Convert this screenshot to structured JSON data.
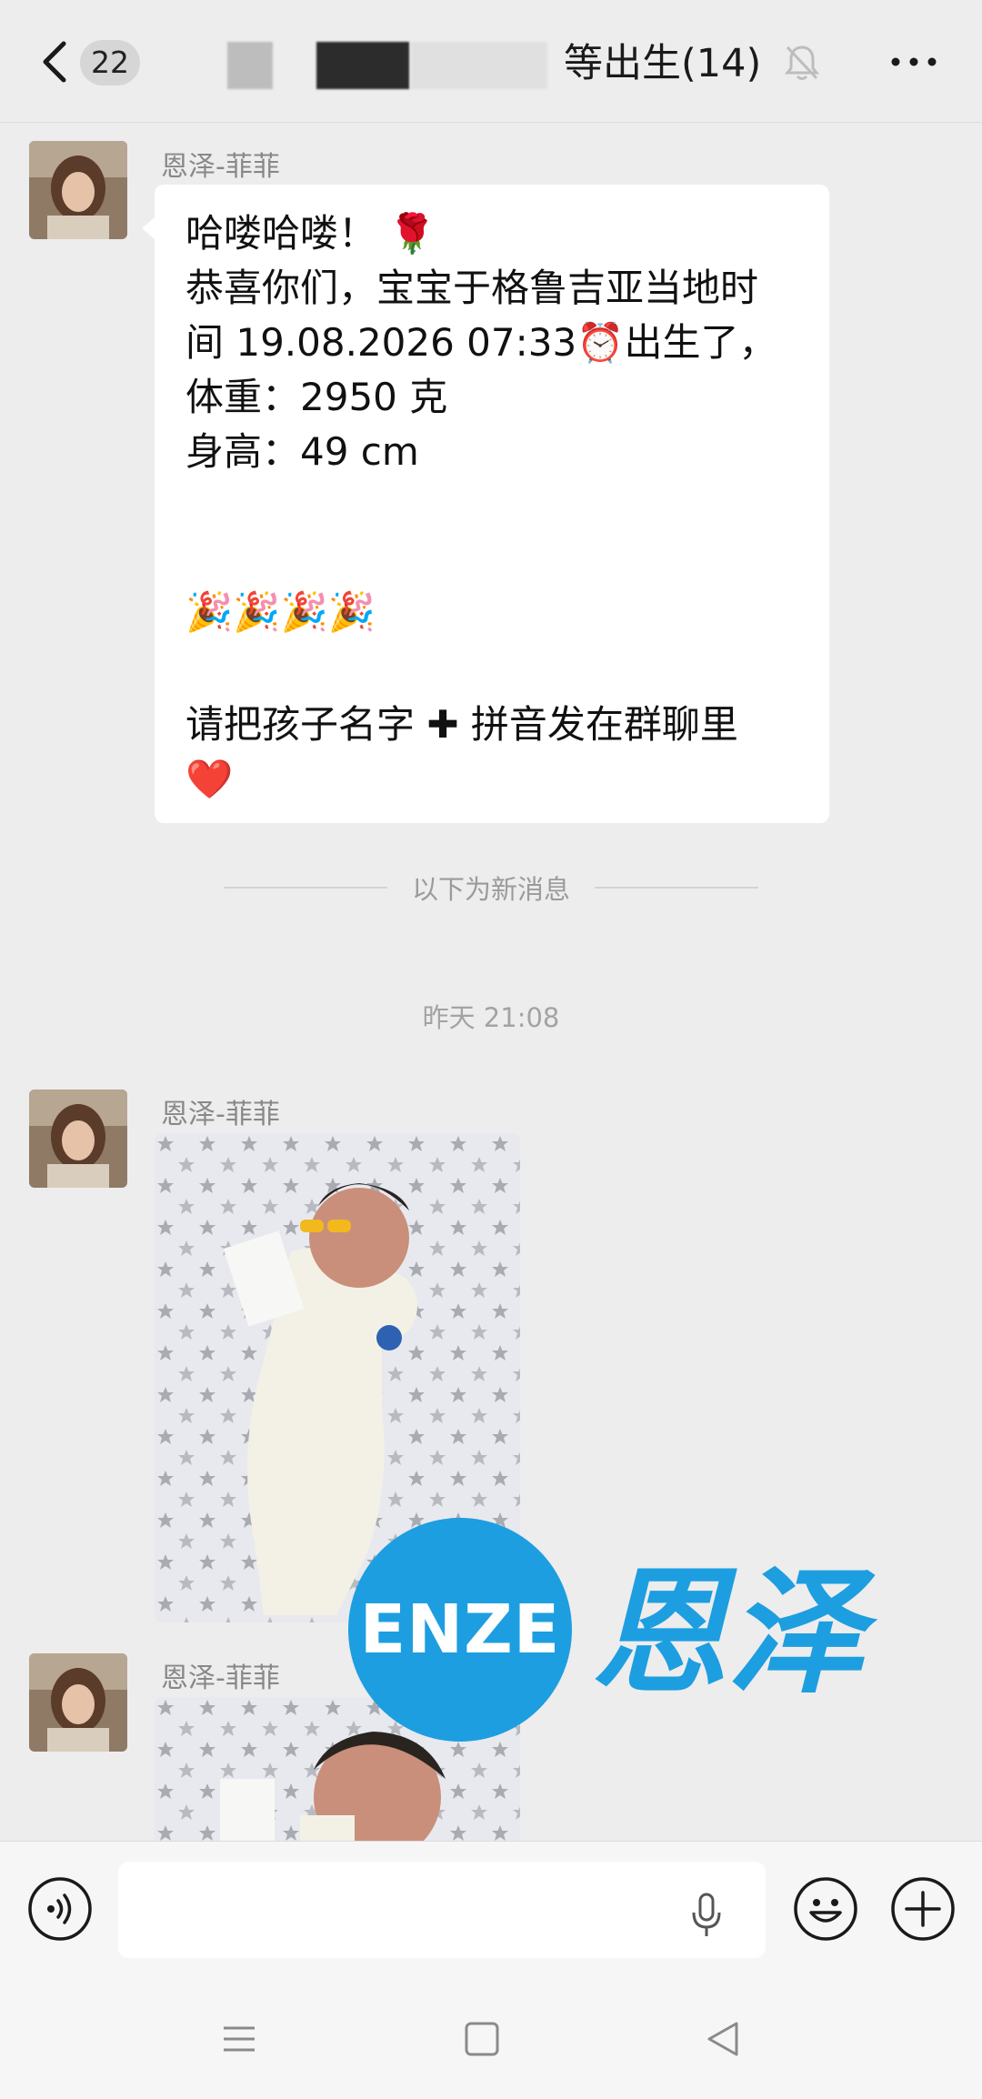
{
  "header": {
    "unread_count": "22",
    "title_visible": "等出生(14)"
  },
  "messages": [
    {
      "sender": "恩泽-菲菲",
      "lines": [
        "哈喽哈喽！ 🌹",
        "恭喜你们，宝宝于格鲁吉亚当地时",
        "间 19.08.2026 07:33⏰出生了，",
        "体重：2950 克",
        "身高：49 cm",
        "🎉🎉🎉🎉",
        "请把孩子名字 ✚ 拼音发在群聊里",
        "❤️"
      ]
    },
    {
      "sender": "恩泽-菲菲"
    },
    {
      "sender": "恩泽-菲菲"
    }
  ],
  "new_message_divider": "以下为新消息",
  "timestamp": "昨天 21:08",
  "watermark": {
    "latin": "ENZE",
    "chinese": "恩泽",
    "color": "#1d9ee0"
  },
  "colors": {
    "background": "#ededed",
    "bubble": "#ffffff",
    "secondary_text": "#888888"
  },
  "icons": {
    "back": "chevron-left-icon",
    "mute": "bell-off-icon",
    "more": "more-dots-icon",
    "voice": "voice-icon",
    "mic": "microphone-icon",
    "emoji": "emoji-icon",
    "add": "plus-icon",
    "nav_menu": "menu-icon",
    "nav_home": "home-square-icon",
    "nav_back": "back-triangle-icon"
  }
}
